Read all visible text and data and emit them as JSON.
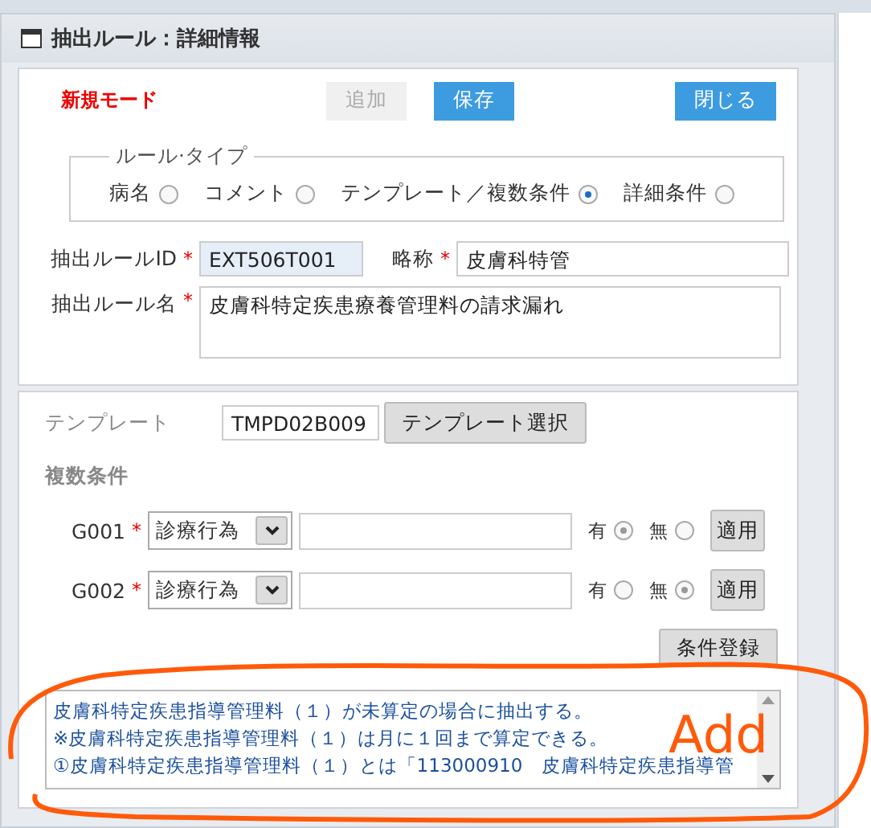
{
  "window": {
    "title": "抽出ルール：詳細情報"
  },
  "mode": "新規モード",
  "buttons": [
    {
      "label": "追加",
      "disabled": true
    },
    {
      "label": "保存",
      "disabled": false
    },
    {
      "label": "閉じる",
      "disabled": false
    }
  ],
  "rule_type": {
    "legend": "ルール·タイプ",
    "options": [
      {
        "label": "病名",
        "selected": false
      },
      {
        "label": "コメント",
        "selected": false
      },
      {
        "label": "テンプレート／複数条件",
        "selected": true
      },
      {
        "label": "詳細条件",
        "selected": false
      }
    ]
  },
  "rule_id": {
    "label": "抽出ルールID",
    "required_mark": "*",
    "value": "EXT506T001"
  },
  "short_name": {
    "label": "略称",
    "required_mark": "*",
    "value": "皮膚科特管"
  },
  "rule_name": {
    "label": "抽出ルール名",
    "required_mark": "*",
    "value": "皮膚科特定疾患療養管理料の請求漏れ"
  },
  "template": {
    "label": "テンプレート",
    "value": "TMPD02B009",
    "button": "テンプレート選択"
  },
  "conditions": {
    "heading": "複数条件",
    "rows": [
      {
        "label": "G001",
        "required_mark": "*",
        "select": "診療行為",
        "value": "",
        "yes_label": "有",
        "no_label": "無",
        "yes": true,
        "apply": "適用"
      },
      {
        "label": "G002",
        "required_mark": "*",
        "select": "診療行為",
        "value": "",
        "yes_label": "有",
        "no_label": "無",
        "yes": false,
        "apply": "適用"
      }
    ],
    "register": "条件登録"
  },
  "description": [
    "皮膚科特定疾患指導管理料（１）が未算定の場合に抽出する。",
    "※皮膚科特定疾患指導管理料（１）は月に１回まで算定できる。",
    "①皮膚科特定疾患指導管理料（１）とは「113000910　皮膚科特定疾患指導管"
  ],
  "annotation": {
    "text": "Add"
  }
}
